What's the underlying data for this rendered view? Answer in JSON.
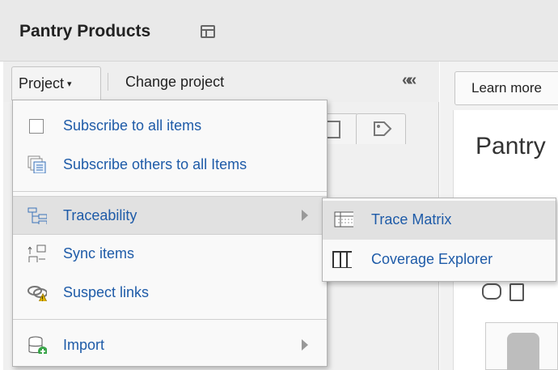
{
  "header": {
    "title": "Pantry Products",
    "icon": "layout-icon"
  },
  "toolbar": {
    "project_label": "Project",
    "caret": "▾",
    "change_project": "Change project",
    "collapse_glyph": "«"
  },
  "right_panel": {
    "learn_more": "Learn more",
    "heading": "Pantry"
  },
  "menu": {
    "items": [
      {
        "label": "Subscribe to all items",
        "icon": "checkbox-icon"
      },
      {
        "label": "Subscribe others to all Items",
        "icon": "subscribe-others-icon"
      },
      {
        "label": "Traceability",
        "icon": "traceability-icon",
        "has_submenu": true
      },
      {
        "label": "Sync items",
        "icon": "sync-items-icon"
      },
      {
        "label": "Suspect links",
        "icon": "suspect-links-icon"
      },
      {
        "label": "Import",
        "icon": "import-icon",
        "has_submenu": true
      }
    ],
    "highlighted": "Traceability"
  },
  "submenu": {
    "items": [
      {
        "label": "Trace Matrix",
        "icon": "trace-matrix-icon"
      },
      {
        "label": "Coverage Explorer",
        "icon": "coverage-explorer-icon"
      }
    ],
    "highlighted": "Trace Matrix"
  },
  "colors": {
    "menu_link": "#1e5ba8",
    "help_icon": "#3d9be2",
    "import_badge": "#3aa54a",
    "suspect_badge": "#e0b400"
  }
}
